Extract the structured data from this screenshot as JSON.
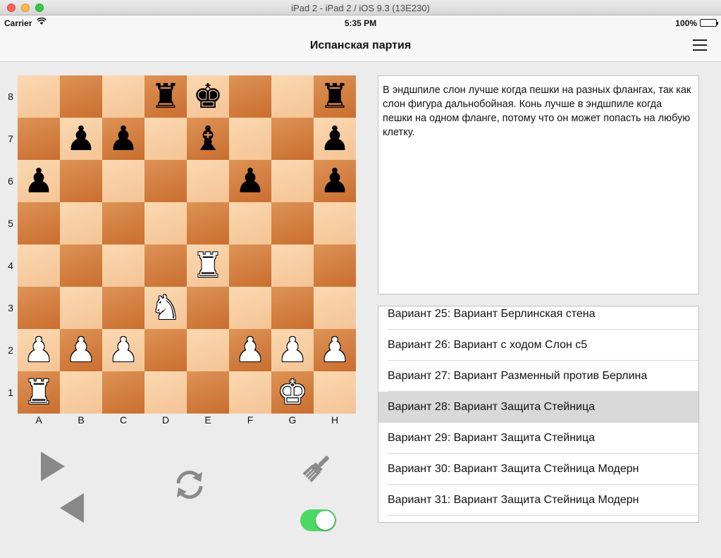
{
  "window": {
    "title": "iPad 2 - iPad 2 / iOS 9.3 (13E230)"
  },
  "status": {
    "carrier": "Carrier",
    "time": "5:35 PM",
    "battery": "100%"
  },
  "nav": {
    "title": "Испанская партия"
  },
  "board": {
    "ranks": [
      "8",
      "7",
      "6",
      "5",
      "4",
      "3",
      "2",
      "1"
    ],
    "files": [
      "A",
      "B",
      "C",
      "D",
      "E",
      "F",
      "G",
      "H"
    ],
    "pieces": [
      {
        "square": "d8",
        "piece": "rook",
        "color": "black",
        "glyph": "♜"
      },
      {
        "square": "e8",
        "piece": "king",
        "color": "black",
        "glyph": "♚"
      },
      {
        "square": "h8",
        "piece": "rook",
        "color": "black",
        "glyph": "♜"
      },
      {
        "square": "b7",
        "piece": "pawn",
        "color": "black",
        "glyph": "♟"
      },
      {
        "square": "c7",
        "piece": "pawn",
        "color": "black",
        "glyph": "♟"
      },
      {
        "square": "e7",
        "piece": "bishop",
        "color": "black",
        "glyph": "♝"
      },
      {
        "square": "h7",
        "piece": "pawn",
        "color": "black",
        "glyph": "♟"
      },
      {
        "square": "a6",
        "piece": "pawn",
        "color": "black",
        "glyph": "♟"
      },
      {
        "square": "f6",
        "piece": "pawn",
        "color": "black",
        "glyph": "♟"
      },
      {
        "square": "h6",
        "piece": "pawn",
        "color": "black",
        "glyph": "♟"
      },
      {
        "square": "e4",
        "piece": "rook",
        "color": "white",
        "glyph": "♜"
      },
      {
        "square": "d3",
        "piece": "knight",
        "color": "white",
        "glyph": "♞"
      },
      {
        "square": "a2",
        "piece": "pawn",
        "color": "white",
        "glyph": "♟"
      },
      {
        "square": "b2",
        "piece": "pawn",
        "color": "white",
        "glyph": "♟"
      },
      {
        "square": "c2",
        "piece": "pawn",
        "color": "white",
        "glyph": "♟"
      },
      {
        "square": "f2",
        "piece": "pawn",
        "color": "white",
        "glyph": "♟"
      },
      {
        "square": "g2",
        "piece": "pawn",
        "color": "white",
        "glyph": "♟"
      },
      {
        "square": "h2",
        "piece": "pawn",
        "color": "white",
        "glyph": "♟"
      },
      {
        "square": "a1",
        "piece": "rook",
        "color": "white",
        "glyph": "♜"
      },
      {
        "square": "g1",
        "piece": "king",
        "color": "white",
        "glyph": "♚"
      }
    ]
  },
  "controls": {
    "next_icon": "play-triangle-icon",
    "prev_icon": "back-triangle-icon",
    "rotate_icon": "rotate-board-icon",
    "brush_icon": "brush-icon",
    "toggle_on": true,
    "toggle_color": "#4cd964"
  },
  "description": "В эндшпиле слон лучше когда пешки на разных флангах, так как слон фигура дальнобойная. Конь лучше в эндшпиле когда пешки на одном фланге, потому что он может попасть на любую клетку.",
  "variants": {
    "items": [
      {
        "label": "Вариант 25: Вариант Берлинская стена",
        "selected": false
      },
      {
        "label": "Вариант 26: Вариант с ходом Слон c5",
        "selected": false
      },
      {
        "label": "Вариант 27: Вариант Разменный против Берлина",
        "selected": false
      },
      {
        "label": "Вариант 28: Вариант Защита Стейница",
        "selected": true
      },
      {
        "label": "Вариант 29: Вариант Защита Стейница",
        "selected": false
      },
      {
        "label": "Вариант 30: Вариант Защита Стейница Модерн",
        "selected": false
      },
      {
        "label": "Вариант 31: Вариант Защита Стейница Модерн",
        "selected": false
      }
    ]
  }
}
